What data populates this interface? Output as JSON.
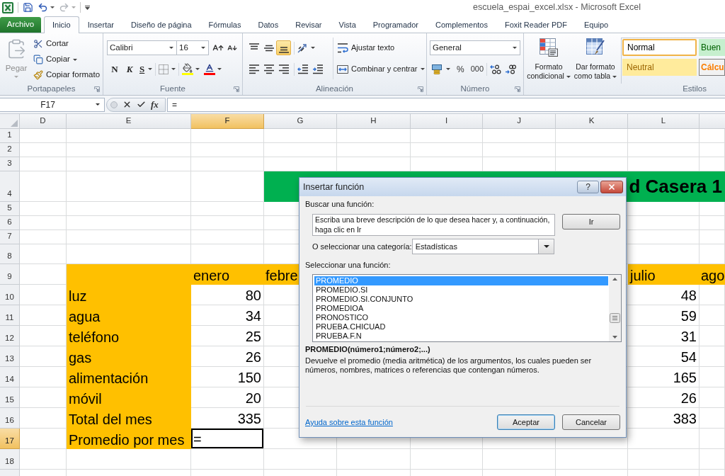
{
  "window": {
    "title": "escuela_espai_excel.xlsx - Microsoft Excel"
  },
  "quick_access": [
    {
      "kind": "save",
      "disabled": false
    },
    {
      "kind": "undo",
      "disabled": false
    },
    {
      "kind": "redo",
      "disabled": true
    }
  ],
  "ribbon_tabs": [
    {
      "label": "Archivo",
      "kind": "file",
      "selected": false
    },
    {
      "label": "Inicio",
      "kind": "tab",
      "selected": true
    },
    {
      "label": "Insertar",
      "kind": "tab",
      "selected": false
    },
    {
      "label": "Diseño de página",
      "kind": "tab",
      "selected": false
    },
    {
      "label": "Fórmulas",
      "kind": "tab",
      "selected": false
    },
    {
      "label": "Datos",
      "kind": "tab",
      "selected": false
    },
    {
      "label": "Revisar",
      "kind": "tab",
      "selected": false
    },
    {
      "label": "Vista",
      "kind": "tab",
      "selected": false
    },
    {
      "label": "Programador",
      "kind": "tab",
      "selected": false
    },
    {
      "label": "Complementos",
      "kind": "tab",
      "selected": false
    },
    {
      "label": "Foxit Reader PDF",
      "kind": "tab",
      "selected": false
    },
    {
      "label": "Equipo",
      "kind": "tab",
      "selected": false
    }
  ],
  "ribbon": {
    "clipboard": {
      "label": "Portapapeles",
      "paste": {
        "label": "Pegar",
        "disabled": true
      },
      "cut": "Cortar",
      "copy": "Copiar",
      "format_painter": "Copiar formato"
    },
    "font": {
      "label": "Fuente",
      "font_name": "Calibri",
      "font_size": "16",
      "bold": "N",
      "italic": "K",
      "underline": "S"
    },
    "alignment": {
      "label": "Alineación",
      "vertical_align": [
        {
          "kind": "top",
          "selected": false
        },
        {
          "kind": "middle",
          "selected": false
        },
        {
          "kind": "bottom",
          "selected": true
        }
      ],
      "wrap_text": "Ajustar texto",
      "merge_center": "Combinar y centrar"
    },
    "number": {
      "label": "Número",
      "format": "General",
      "percent": "%",
      "thousands": "000"
    },
    "styles": {
      "label": "Estilos",
      "conditional_format": "Formato condicional",
      "format_as_table": "Dar formato como tabla",
      "gallery": [
        {
          "label": "Normal",
          "kind": "normal",
          "selected": true
        },
        {
          "label": "Buen",
          "kind": "good",
          "selected": false
        },
        {
          "label": "Neutral",
          "kind": "neutral",
          "selected": false
        },
        {
          "label": "Cálcu",
          "kind": "calculation",
          "selected": false
        }
      ]
    }
  },
  "formula_bar": {
    "name_box": "F17",
    "function_button": "fx",
    "formula": "="
  },
  "sheet": {
    "columns": [
      {
        "label": "D",
        "selected": false
      },
      {
        "label": "E",
        "selected": false
      },
      {
        "label": "F",
        "selected": true
      },
      {
        "label": "G",
        "selected": false
      },
      {
        "label": "H",
        "selected": false
      },
      {
        "label": "I",
        "selected": false
      },
      {
        "label": "J",
        "selected": false
      },
      {
        "label": "K",
        "selected": false
      },
      {
        "label": "L",
        "selected": false
      }
    ],
    "rows": [
      {
        "label": "1",
        "selected": false
      },
      {
        "label": "2",
        "selected": false
      },
      {
        "label": "3",
        "selected": false
      },
      {
        "label": "4",
        "selected": false
      },
      {
        "label": "5",
        "selected": false
      },
      {
        "label": "6",
        "selected": false
      },
      {
        "label": "7",
        "selected": false
      },
      {
        "label": "8",
        "selected": false
      },
      {
        "label": "9",
        "selected": false
      },
      {
        "label": "10",
        "selected": false
      },
      {
        "label": "11",
        "selected": false
      },
      {
        "label": "12",
        "selected": false
      },
      {
        "label": "13",
        "selected": false
      },
      {
        "label": "14",
        "selected": false
      },
      {
        "label": "15",
        "selected": false
      },
      {
        "label": "16",
        "selected": false
      },
      {
        "label": "17",
        "selected": true
      },
      {
        "label": "18",
        "selected": false
      }
    ],
    "banner": "d Casera 1",
    "months": [
      "enero",
      "febre",
      "julio",
      "ago"
    ],
    "expenses": [
      {
        "label": "luz",
        "values": [
          "80",
          "48"
        ]
      },
      {
        "label": "agua",
        "values": [
          "34",
          "59"
        ]
      },
      {
        "label": "teléfono",
        "values": [
          "25",
          "31"
        ]
      },
      {
        "label": "gas",
        "values": [
          "26",
          "54"
        ]
      },
      {
        "label": "alimentación",
        "values": [
          "150",
          "165"
        ]
      },
      {
        "label": "móvil",
        "values": [
          "20",
          "26"
        ]
      }
    ],
    "total": {
      "label": "Total del mes",
      "values": [
        "335",
        "383"
      ]
    },
    "average": {
      "label": "Promedio por mes",
      "value": "=",
      "active": true
    }
  },
  "dialog": {
    "title": "Insertar función",
    "help_button": "?",
    "search_label": "Buscar una función:",
    "search_value": "Escriba una breve descripción de lo que desea hacer y, a continuación, haga clic en Ir",
    "go_button": "Ir",
    "category_label": "O seleccionar una categoría:",
    "category": "Estadísticas",
    "function_label": "Seleccionar una función:",
    "functions": [
      {
        "name": "PROMEDIO",
        "selected": true
      },
      {
        "name": "PROMEDIO.SI",
        "selected": false
      },
      {
        "name": "PROMEDIO.SI.CONJUNTO",
        "selected": false
      },
      {
        "name": "PROMEDIOA",
        "selected": false
      },
      {
        "name": "PRONOSTICO",
        "selected": false
      },
      {
        "name": "PRUEBA.CHICUAD",
        "selected": false
      },
      {
        "name": "PRUEBA.F.N",
        "selected": false
      }
    ],
    "signature": "PROMEDIO(número1;número2;...)",
    "description": "Devuelve el promedio (media aritmética) de los argumentos, los cuales pueden ser números, nombres, matrices o referencias que contengan números.",
    "help_link": "Ayuda sobre esta función",
    "buttons": [
      {
        "label": "Aceptar",
        "kind": "default"
      },
      {
        "label": "Cancelar",
        "kind": "normal"
      }
    ]
  }
}
